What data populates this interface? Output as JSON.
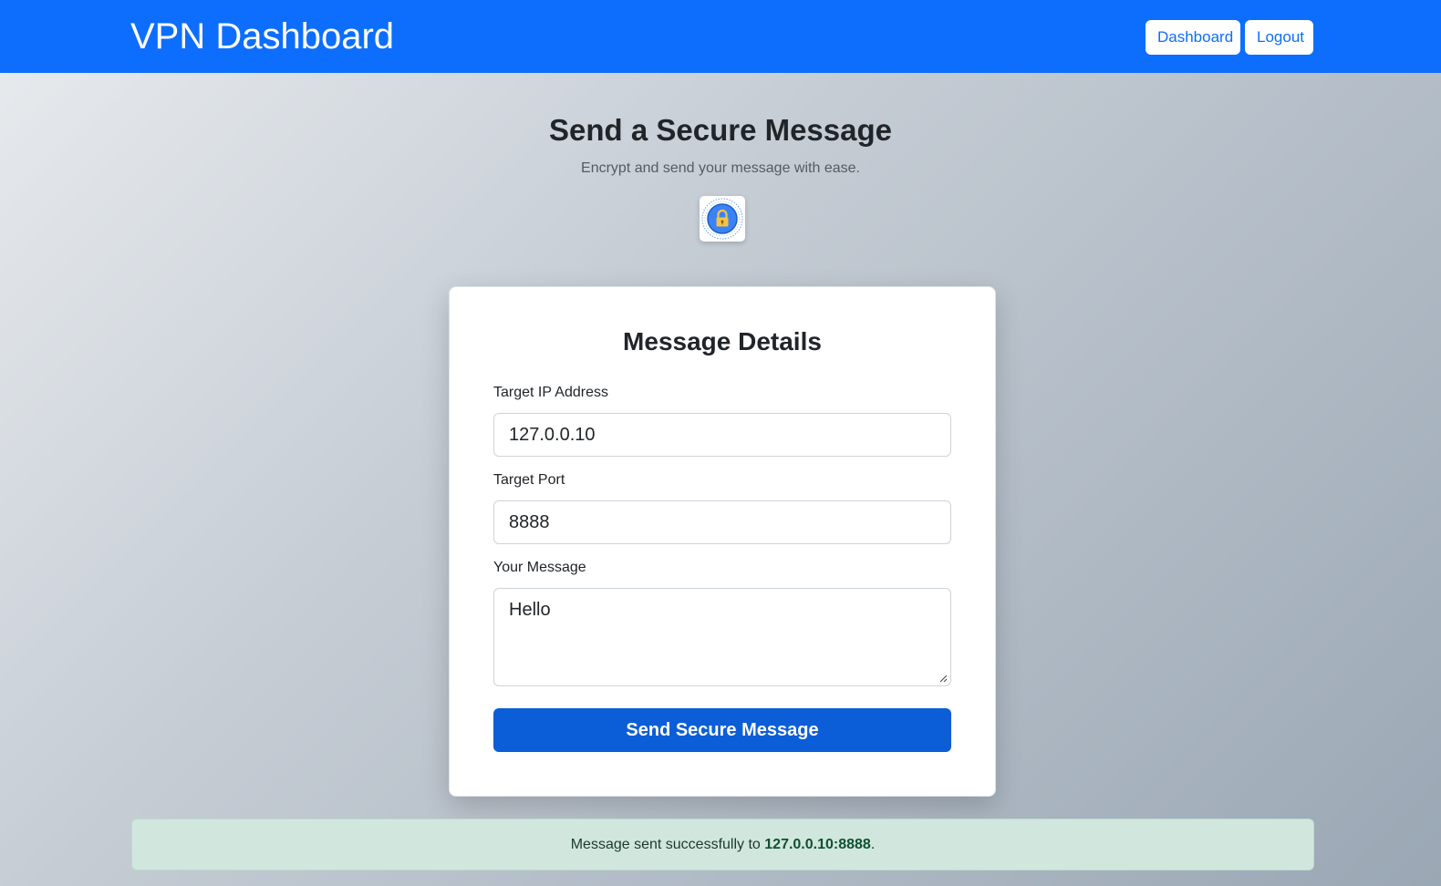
{
  "navbar": {
    "brand": "VPN Dashboard",
    "dashboard_label": "Dashboard",
    "logout_label": "Logout",
    "bg_color": "#0d6efd"
  },
  "hero": {
    "title": "Send a Secure Message",
    "subtitle": "Encrypt and send your message with ease.",
    "logo_icon": "padlock-icon"
  },
  "form": {
    "title": "Message Details",
    "ip_label": "Target IP Address",
    "ip_value": "127.0.0.10",
    "port_label": "Target Port",
    "port_value": "8888",
    "message_label": "Your Message",
    "message_value": "Hello",
    "submit_label": "Send Secure Message",
    "submit_color": "#0b5ed7"
  },
  "alert": {
    "prefix": "Message sent successfully to ",
    "target": "127.0.0.10:8888",
    "suffix": ".",
    "bg_color": "#d1e7dd"
  }
}
